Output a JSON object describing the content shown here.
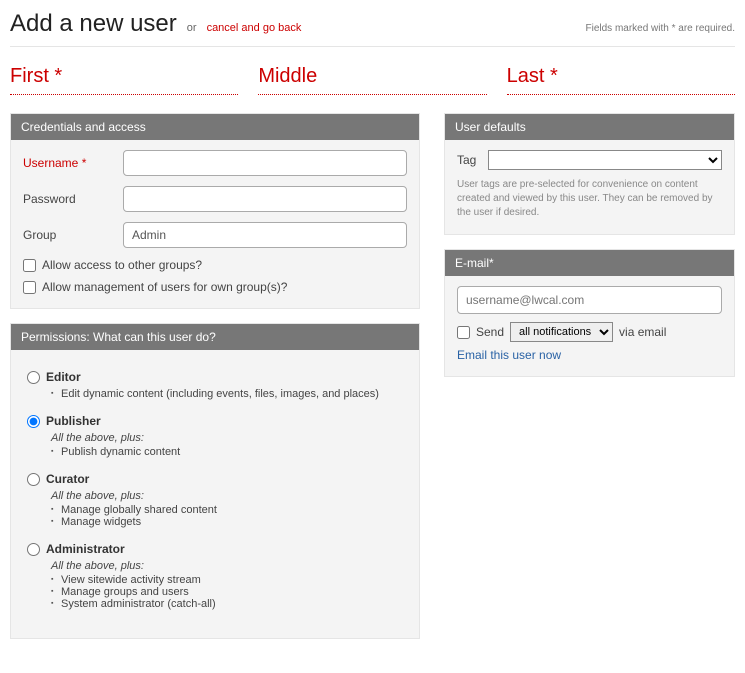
{
  "header": {
    "title": "Add a new user",
    "or": "or",
    "cancel": "cancel and go back",
    "required_note": "Fields marked with * are required."
  },
  "name": {
    "first_ph": "First *",
    "middle_ph": "Middle",
    "last_ph": "Last *"
  },
  "credentials": {
    "panel_title": "Credentials and access",
    "username_label": "Username *",
    "password_label": "Password",
    "group_label": "Group",
    "group_value": "Admin",
    "allow_other": "Allow access to other groups?",
    "allow_manage": "Allow management of users for own group(s)?"
  },
  "permissions": {
    "panel_title": "Permissions: What can this user do?",
    "all_above": "All the above, plus:",
    "roles": [
      {
        "key": "editor",
        "label": "Editor",
        "selected": false,
        "items": [
          "Edit dynamic content (including events, files, images, and places)"
        ]
      },
      {
        "key": "publisher",
        "label": "Publisher",
        "selected": true,
        "items": [
          "Publish dynamic content"
        ]
      },
      {
        "key": "curator",
        "label": "Curator",
        "selected": false,
        "items": [
          "Manage globally shared content",
          "Manage widgets"
        ]
      },
      {
        "key": "administrator",
        "label": "Administrator",
        "selected": false,
        "items": [
          "View sitewide activity stream",
          "Manage groups and users",
          "System administrator (catch-all)"
        ]
      }
    ]
  },
  "defaults": {
    "panel_title": "User defaults",
    "tag_label": "Tag",
    "help": "User tags are pre-selected for convenience on content created and viewed by this user. They can be removed by the user if desired."
  },
  "email": {
    "panel_title": "E-mail*",
    "placeholder": "username@lwcal.com",
    "send_label": "Send",
    "send_option": "all notifications",
    "via": "via email",
    "link": "Email this user now"
  }
}
